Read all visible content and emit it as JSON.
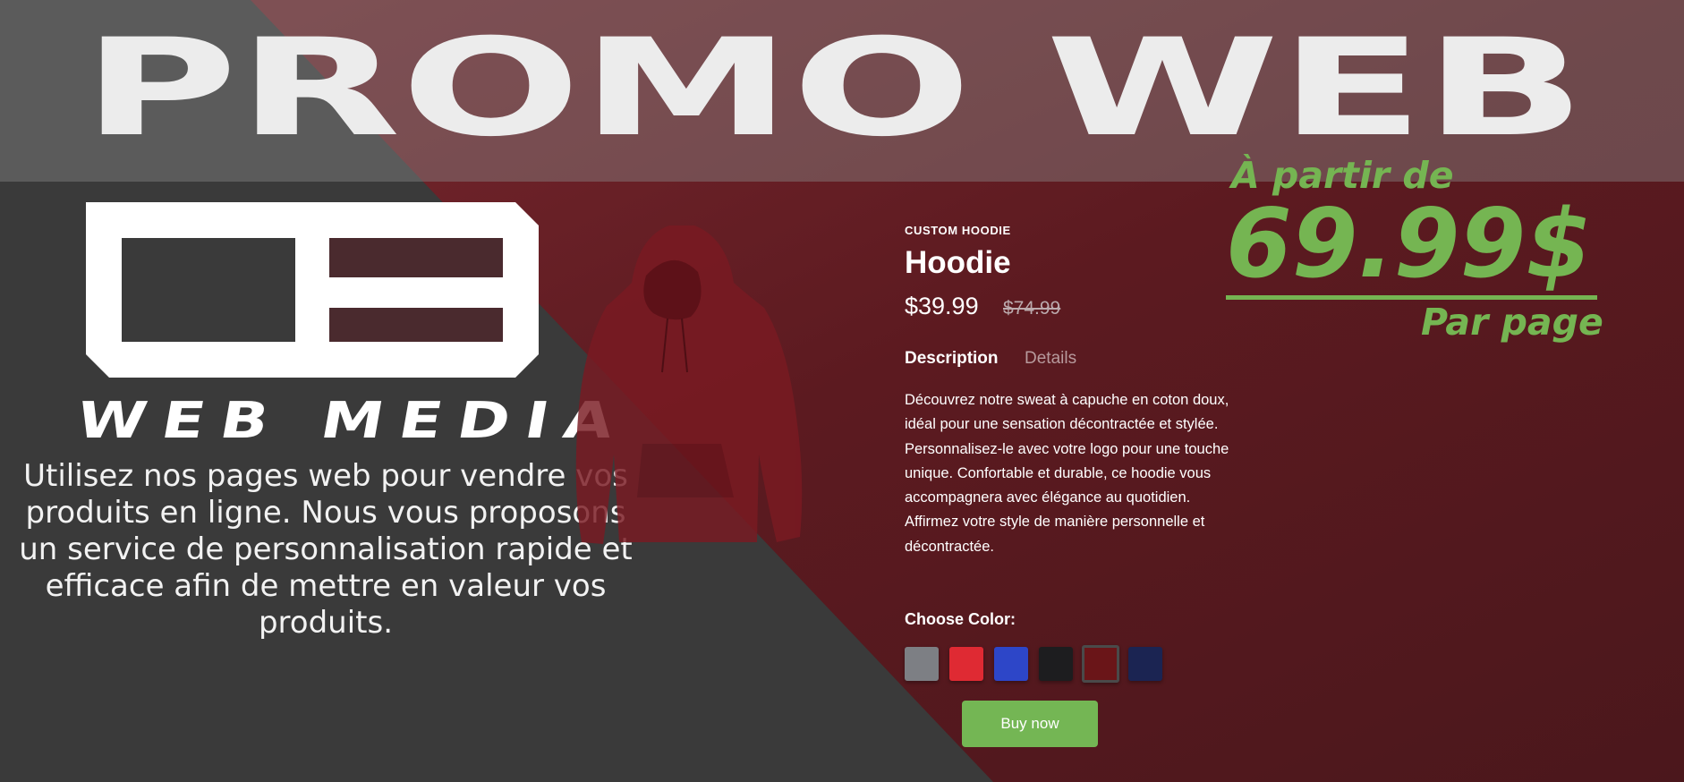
{
  "banner": {
    "title": "PROMO WEB"
  },
  "brand": {
    "logo_mark": "OB",
    "logo_word": "WEB MEDIA"
  },
  "pitch": "Utilisez nos pages web pour vendre vos produits en ligne. Nous vous proposons un service de personnalisation rapide et efficace afin de mettre en valeur vos produits.",
  "product": {
    "eyebrow": "CUSTOM HOODIE",
    "name": "Hoodie",
    "price": "$39.99",
    "old_price": "$74.99",
    "tabs": [
      {
        "label": "Description",
        "active": true
      },
      {
        "label": "Details",
        "active": false
      }
    ],
    "description": "Découvrez notre sweat à capuche en coton doux, idéal pour une sensation décontractée et stylée. Personnalisez-le avec votre logo pour une touche unique. Confortable et durable, ce hoodie vous accompagnera avec élégance au quotidien. Affirmez votre style de manière personnelle et décontractée.",
    "color_label": "Choose Color:",
    "colors": [
      {
        "name": "gray",
        "hex": "#7d7f84"
      },
      {
        "name": "red",
        "hex": "#df2a33"
      },
      {
        "name": "blue",
        "hex": "#2d46c8"
      },
      {
        "name": "black",
        "hex": "#1d1d1f"
      },
      {
        "name": "maroon",
        "hex": "#6a1518",
        "selected": true
      },
      {
        "name": "navy",
        "hex": "#1b2452"
      }
    ],
    "buy_label": "Buy now"
  },
  "promo": {
    "from": "À partir de",
    "price": "69.99$",
    "per": "Par page"
  },
  "colors": {
    "background_dark": "#3a3a3a",
    "background_red": "#5e1a20",
    "accent_green": "#75b552"
  }
}
